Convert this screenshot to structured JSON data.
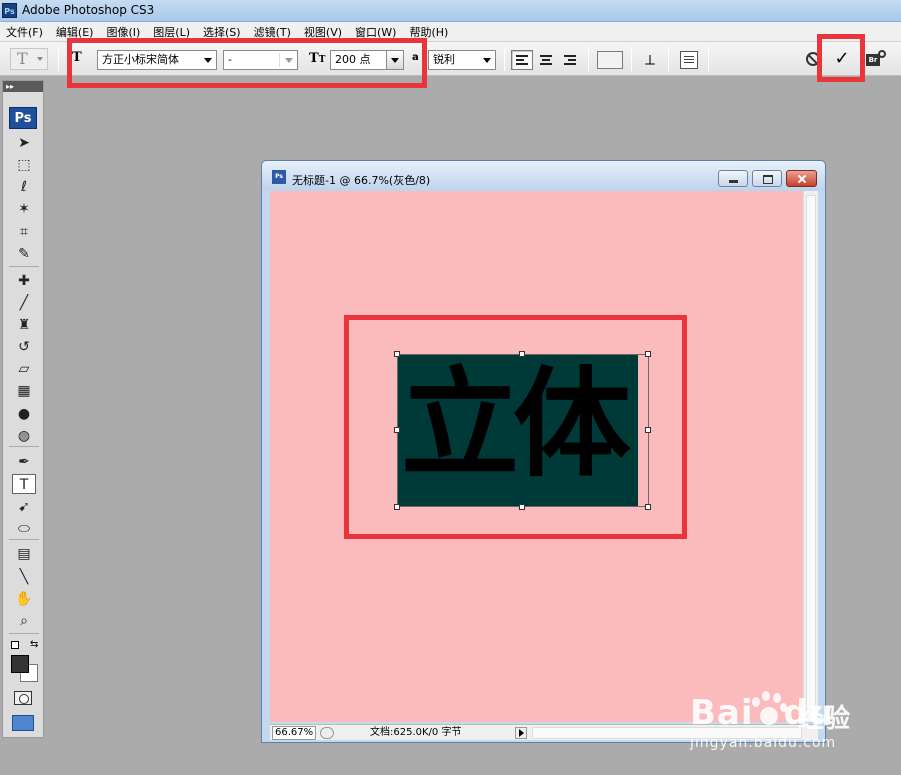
{
  "app": {
    "title": "Adobe Photoshop CS3",
    "logo": "Ps"
  },
  "menu": [
    "文件(F)",
    "编辑(E)",
    "图像(I)",
    "图层(L)",
    "选择(S)",
    "滤镜(T)",
    "视图(V)",
    "窗口(W)",
    "帮助(H)"
  ],
  "options": {
    "tool_preset_glyph": "T",
    "orientation_glyph": "T",
    "font_family": "方正小标宋简体",
    "font_style": "-",
    "size_glyph": "T",
    "font_size": "200 点",
    "aa_glyph": "a",
    "antialias": "锐利",
    "commit_glyph": "✓",
    "bridge_label": "Br",
    "warp_glyph": "⟂"
  },
  "toolbox": {
    "grip": "▸▸",
    "badge": "Ps",
    "tools": [
      {
        "name": "move-tool",
        "glyph": "➤"
      },
      {
        "name": "marquee-tool",
        "glyph": "⬚"
      },
      {
        "name": "lasso-tool",
        "glyph": "ℓ"
      },
      {
        "name": "magic-wand-tool",
        "glyph": "✶"
      },
      {
        "name": "crop-tool",
        "glyph": "⌗"
      },
      {
        "name": "slice-tool",
        "glyph": "✎"
      },
      {
        "name": "healing-brush-tool",
        "glyph": "✚"
      },
      {
        "name": "brush-tool",
        "glyph": "╱"
      },
      {
        "name": "clone-stamp-tool",
        "glyph": "♜"
      },
      {
        "name": "history-brush-tool",
        "glyph": "↺"
      },
      {
        "name": "eraser-tool",
        "glyph": "▱"
      },
      {
        "name": "gradient-tool",
        "glyph": "▦"
      },
      {
        "name": "blur-tool",
        "glyph": "●"
      },
      {
        "name": "dodge-tool",
        "glyph": "◍"
      },
      {
        "name": "pen-tool",
        "glyph": "✒"
      },
      {
        "name": "type-tool",
        "glyph": "T"
      },
      {
        "name": "path-selection-tool",
        "glyph": "➹"
      },
      {
        "name": "ellipse-tool",
        "glyph": "⬭"
      },
      {
        "name": "notes-tool",
        "glyph": "▤"
      },
      {
        "name": "eyedropper-tool",
        "glyph": "╲"
      },
      {
        "name": "hand-tool",
        "glyph": "✋"
      },
      {
        "name": "zoom-tool",
        "glyph": "⌕"
      }
    ]
  },
  "document": {
    "title": "无标题-1 @ 66.7%(灰色/8)",
    "icon": "Ps",
    "canvas_color": "#fbbabb",
    "text": "立体",
    "text_bg": "#003a38",
    "zoom": "66.67%",
    "doc_info": "文档:625.0K/0 字节"
  },
  "watermark": {
    "brand": "Bai",
    "brand2": "du",
    "cn": "经验",
    "url": "jingyan.baidu.com"
  },
  "colors": {
    "highlight": "#e8343a",
    "accent": "#1e4f9c"
  }
}
